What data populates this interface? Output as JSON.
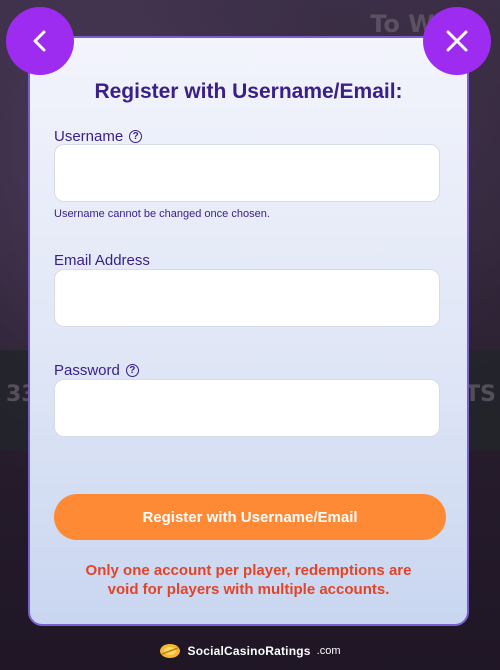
{
  "background": {
    "headline": "To Win",
    "left_number": "33",
    "right_text": "TS"
  },
  "nav": {
    "back_icon": "chevron-left-icon",
    "close_icon": "close-icon"
  },
  "form": {
    "title": "Register with Username/Email:",
    "username_label": "Username",
    "username_value": "",
    "username_hint": "Username cannot be changed once chosen.",
    "email_label": "Email Address",
    "email_value": "",
    "password_label": "Password",
    "password_value": "",
    "help_icon": "question-circle-icon",
    "submit_label": "Register with Username/Email",
    "warning_line1": "Only one account per player, redemptions are",
    "warning_line2": "void for players with multiple accounts."
  },
  "footer": {
    "brand": "SocialCasinoRatings",
    "domain": ".com"
  },
  "colors": {
    "accent_purple": "#9d2cf0",
    "title_text": "#3a1e8a",
    "button_orange": "#ff8a35",
    "warning_red": "#e0452a"
  }
}
